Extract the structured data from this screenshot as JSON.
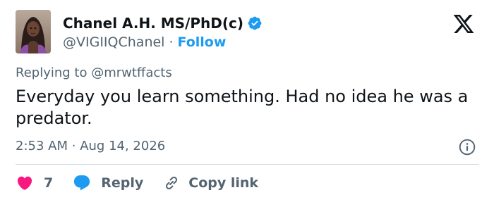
{
  "user": {
    "display_name": "Chanel A.H. MS/PhD(c)",
    "handle": "@VIGIIQChanel",
    "separator": "·",
    "follow_label": "Follow",
    "verified_icon": "verified-badge-icon",
    "avatar": "profile-photo"
  },
  "tweet": {
    "replying_prefix": "Replying to",
    "replying_to": "@mrwtffacts",
    "text": "Everyday you learn something. Had no idea he was a predator.",
    "time": "2:53 AM",
    "separator": "·",
    "date": "Aug 14, 2026"
  },
  "actions": {
    "like_count": "7",
    "reply_label": "Reply",
    "copy_label": "Copy link"
  },
  "colors": {
    "accent": "#1d9bf0",
    "like": "#f91880",
    "text_primary": "#0f1419",
    "text_secondary": "#536471",
    "divider": "#cfd9de"
  }
}
